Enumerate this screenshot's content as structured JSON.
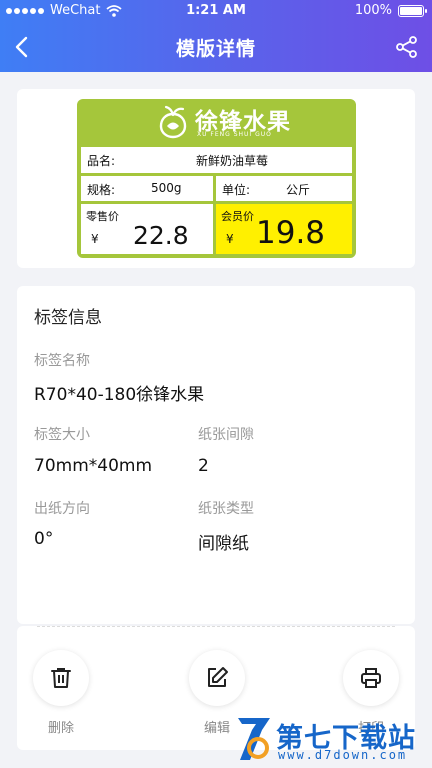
{
  "status": {
    "carrier": "WeChat",
    "time": "1:21 AM",
    "battery": "100%"
  },
  "nav": {
    "title": "模版详情"
  },
  "label": {
    "brand_cn": "徐锋水果",
    "brand_en": "XU FENG SHUI GUO",
    "product_key": "品名:",
    "product_value": "新鲜奶油草莓",
    "spec_key": "规格:",
    "spec_value": "500g",
    "unit_key": "单位:",
    "unit_value": "公斤",
    "retail_key": "零售价",
    "retail_currency": "¥",
    "retail_price": "22.8",
    "member_key": "会员价",
    "member_currency": "¥",
    "member_price": "19.8",
    "colors": {
      "background": "#a5c63b",
      "member_highlight": "#fff000"
    }
  },
  "info": {
    "section_title": "标签信息",
    "name_key": "标签名称",
    "name_value": "R70*40-180徐锋水果",
    "size_key": "标签大小",
    "size_value": "70mm*40mm",
    "gap_key": "纸张间隙",
    "gap_value": "2",
    "direction_key": "出纸方向",
    "direction_value": "0°",
    "paper_key": "纸张类型",
    "paper_value": "间隙纸"
  },
  "actions": [
    {
      "label": "删除",
      "icon": "trash-icon"
    },
    {
      "label": "编辑",
      "icon": "edit-icon"
    },
    {
      "label": "打印",
      "icon": "printer-icon"
    }
  ],
  "watermark": {
    "cn": "第七下载站",
    "en": "www.d7down.com",
    "color": "#1666c9"
  },
  "theme": {
    "header_gradient": [
      "#3f7ef5",
      "#6e4fe6"
    ]
  }
}
